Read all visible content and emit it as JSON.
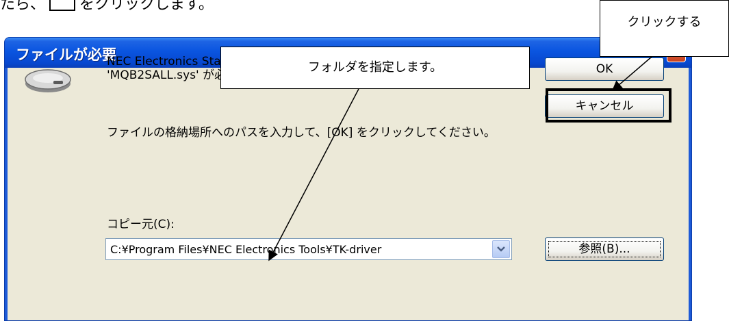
{
  "top_fragment": {
    "text_before": "たら、",
    "text_after": "をクリックします。"
  },
  "dialog": {
    "title": "ファイルが必要",
    "close_glyph": "✕",
    "message1": "NEC Electronics Starter Kit Virtual UART install disk 上の ファイル 'MQB2SALL.sys' が必要です。",
    "message2": "ファイルの格納場所へのパスを入力して、[OK] をクリックしてください。",
    "copy_from_label": "コピー元(C):",
    "copy_from_value": "C:¥Program Files¥NEC Electronics Tools¥TK-driver",
    "ok_button": "OK",
    "cancel_button": "キャンセル",
    "browse_button": "参照(B)...",
    "icon": "disk-drive-icon"
  },
  "annotations": {
    "folder_callout": "フォルダを指定します。",
    "click_callout": "クリックする"
  },
  "colors": {
    "titlebar": "#0a55e0",
    "dialog_face": "#ece9d8",
    "close_button": "#c9421f"
  }
}
